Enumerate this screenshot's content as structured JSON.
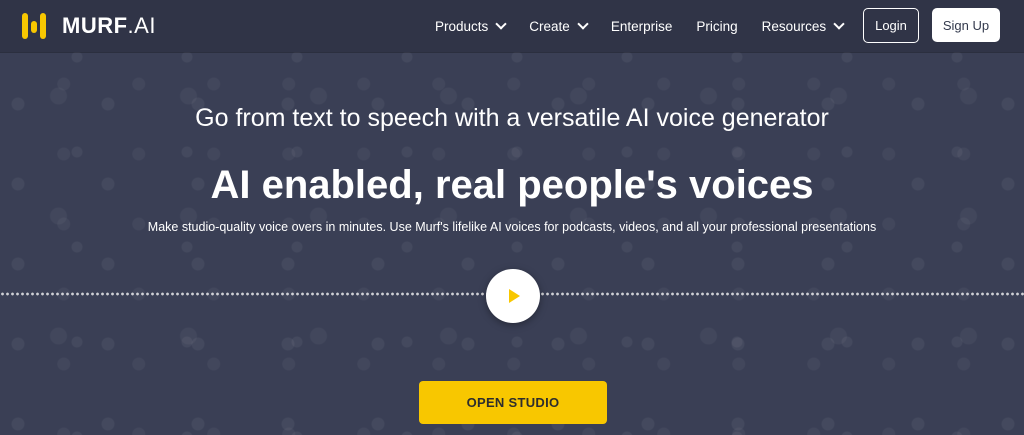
{
  "brand": {
    "name": "MURF",
    "suffix": ".AI",
    "accent_color": "#f8c700"
  },
  "nav": {
    "items": [
      {
        "label": "Products",
        "has_dropdown": true
      },
      {
        "label": "Create",
        "has_dropdown": true
      },
      {
        "label": "Enterprise",
        "has_dropdown": false
      },
      {
        "label": "Pricing",
        "has_dropdown": false
      },
      {
        "label": "Resources",
        "has_dropdown": true
      }
    ],
    "login_label": "Login",
    "signup_label": "Sign Up"
  },
  "hero": {
    "subheading": "Go from text to speech with a versatile AI voice generator",
    "heading": "AI enabled, real people's voices",
    "description": "Make studio-quality voice overs in minutes. Use Murf's lifelike AI voices for podcasts, videos, and all your professional presentations",
    "play_icon": "play-icon",
    "cta_label": "OPEN STUDIO"
  }
}
